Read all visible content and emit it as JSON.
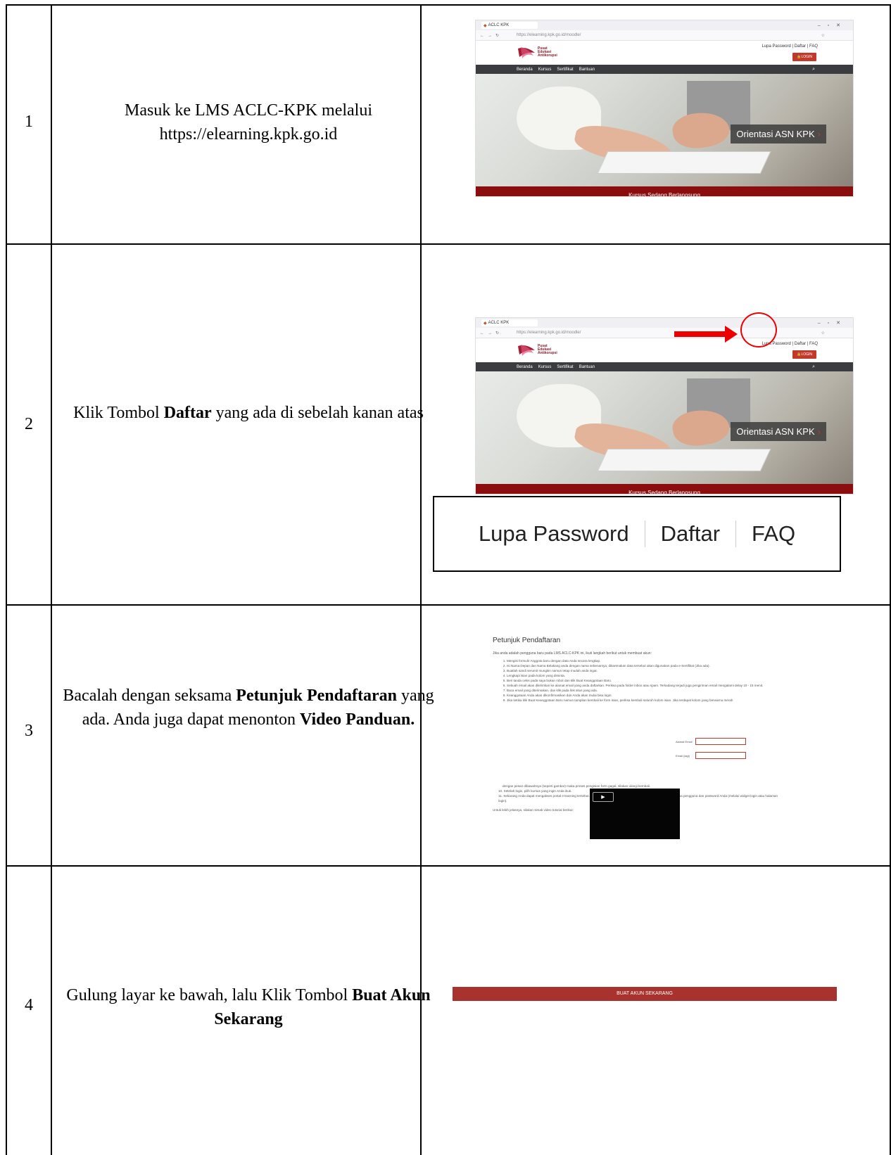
{
  "rows": [
    {
      "num": "1",
      "text": "Masuk ke LMS ACLC-KPK melalui https://elearning.kpk.go.id"
    },
    {
      "num": "2",
      "text_a": "Klik Tombol ",
      "bold_a": "Daftar",
      "text_b": " yang ada di sebelah kanan atas"
    },
    {
      "num": "3",
      "text_a": "Bacalah dengan seksama ",
      "bold_a": "Petunjuk Pendaftaran",
      "text_b": " yang ada. Anda juga dapat menonton ",
      "bold_b": "Video Panduan."
    },
    {
      "num": "4",
      "text_a": "Gulung layar ke bawah, lalu Klik Tombol ",
      "bold_a": "Buat Akun Sekarang"
    }
  ],
  "browser": {
    "tab_title": "ACLC KPK",
    "url": "https://elearning.kpk.go.id/moodle/",
    "logo_text": [
      "Pusat",
      "Edukasi",
      "Antikorupsi"
    ],
    "top_links": "Lupa Password | Daftar | FAQ",
    "login": "LOGIN",
    "nav": [
      "Beranda",
      "Kursus",
      "Sertifikat",
      "Bantuan"
    ],
    "hero_label": "Orientasi ASN KPK",
    "hero_arrow": "›",
    "bottom_bar": "Kursus Sedang Berlangsung"
  },
  "zoom_links": {
    "lupa": "Lupa Password",
    "daftar": "Daftar",
    "faq": "FAQ"
  },
  "petunjuk": {
    "title": "Petunjuk Pendaftaran",
    "intro": "Jika anda adalah pengguna baru pada LMS ACLC-KPK ini, ikuti langkah berikut untuk membuat akun:",
    "steps": [
      "Mengisi formulir Anggota baru dengan data Anda secara lengkap.",
      "Isi Nama Depan dan Nama Belakang anda dengan nama sebenarnya, dikarenakan data tersebut akan digunakan pada e-Sertifikat (Jika ada).",
      "Buatlah sandi serumit mungkin namun tetap mudah anda ingat.",
      "Lengkapi isian pada kolom yang diminta.",
      "Beri tanda cekis pada saya bukan robot dan klik Buat Keanggotaan Baru.",
      "Sebuah email akan dikirimkan ke alamat email yang anda daftarkan. Periksa pada folder inbox atau spam. Terkadang terjadi juga pengiriman email mengalami delay 10 - 15 menit.",
      "Baca email yang diterimakan, dan klik pada link situs yang ada.",
      "Keanggotaan Anda akan dikonfirmasikan dan Anda akan mulai bisa login.",
      "Jika ketika klik Buat Keanggotaan Baru namun tampilan kembali ke form isian, periksa kembali seluruh kolom isian. Jika terdapat kolom yang berwarna merah"
    ],
    "form_label_1": "Alamat Email",
    "form_label_2": "Email (lagi)",
    "after_form": "dengan pesan dibawahnya (seperti gambar) maka proses pengisian form gagal, silakan ulangi kembali.",
    "step10": "10. Setelah login, pilih kursus yang ingin Anda ikuti.",
    "step11": "11. Sekarang Anda dapat mengakses portal e-learning tersebut. Selanjutnya Anda sudah bisa akses dengan memasukkan nama pengguna dan password Anda (melalui widget login atau halaman login).",
    "video_note": "Untuk lebih jelasnya, silakan simak video tutorial berikut:",
    "play": "▶"
  },
  "buat_akun_button": "BUAT AKUN SEKARANG"
}
